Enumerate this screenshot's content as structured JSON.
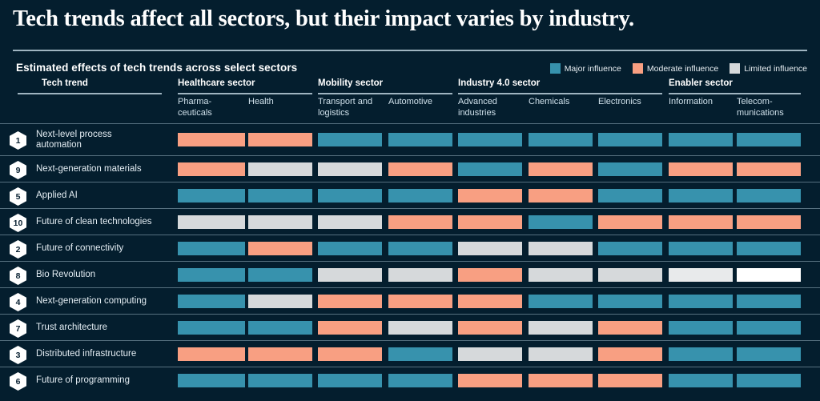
{
  "headline": "Tech trends affect all sectors, but their impact varies by industry.",
  "subhead": "Estimated effects of tech trends across select sectors",
  "legend": {
    "items": [
      {
        "label": "Major influence",
        "key": "major",
        "color": "#3792ad"
      },
      {
        "label": "Moderate influence",
        "key": "moderate",
        "color": "#f89f82"
      },
      {
        "label": "Limited influence",
        "key": "limited",
        "color": "#d6d9db"
      }
    ]
  },
  "row_header_label": "Tech trend",
  "sector_groups": [
    {
      "label": "Healthcare sector",
      "span": 2
    },
    {
      "label": "Mobility sector",
      "span": 2
    },
    {
      "label": "Industry 4.0 sector",
      "span": 3
    },
    {
      "label": "Enabler sector",
      "span": 2
    }
  ],
  "columns": [
    {
      "label": "Pharma-\nceuticals"
    },
    {
      "label": "Health"
    },
    {
      "label": "Transport and\nlogistics"
    },
    {
      "label": "Automotive"
    },
    {
      "label": "Advanced\nindustries"
    },
    {
      "label": "Chemicals"
    },
    {
      "label": "Electronics"
    },
    {
      "label": "Information"
    },
    {
      "label": "Telecom-\nmunications"
    }
  ],
  "chart_data": {
    "type": "heatmap",
    "title": "Estimated effects of tech trends across select sectors",
    "xlabel": "",
    "ylabel": "",
    "categories": [
      "Pharmaceuticals",
      "Health",
      "Transport and logistics",
      "Automotive",
      "Advanced industries",
      "Chemicals",
      "Electronics",
      "Information",
      "Telecommunications"
    ],
    "value_scale": [
      "limited",
      "moderate",
      "major"
    ],
    "legend_position": "top-right",
    "grid": false,
    "rows": [
      {
        "rank": "1",
        "label": "Next-level process automation",
        "values": [
          "moderate",
          "moderate",
          "major",
          "major",
          "major",
          "major",
          "major",
          "major",
          "major"
        ]
      },
      {
        "rank": "9",
        "label": "Next-generation materials",
        "values": [
          "moderate",
          "limited",
          "limited",
          "moderate",
          "major",
          "moderate",
          "major",
          "moderate",
          "moderate"
        ]
      },
      {
        "rank": "5",
        "label": "Applied AI",
        "values": [
          "major",
          "major",
          "major",
          "major",
          "moderate",
          "moderate",
          "major",
          "major",
          "major"
        ]
      },
      {
        "rank": "10",
        "label": "Future of clean technologies",
        "values": [
          "limited",
          "limited",
          "limited",
          "moderate",
          "moderate",
          "major",
          "moderate",
          "moderate",
          "moderate"
        ]
      },
      {
        "rank": "2",
        "label": "Future of connectivity",
        "values": [
          "major",
          "moderate",
          "major",
          "major",
          "limited",
          "limited",
          "major",
          "major",
          "major"
        ]
      },
      {
        "rank": "8",
        "label": "Bio Revolution",
        "values": [
          "major",
          "major",
          "limited",
          "limited",
          "moderate",
          "limited",
          "limited",
          "limited",
          "limited"
        ],
        "highlight": [
          7,
          8
        ]
      },
      {
        "rank": "4",
        "label": "Next-generation computing",
        "values": [
          "major",
          "limited",
          "moderate",
          "moderate",
          "moderate",
          "major",
          "major",
          "major",
          "major"
        ]
      },
      {
        "rank": "7",
        "label": "Trust architecture",
        "values": [
          "major",
          "major",
          "moderate",
          "limited",
          "moderate",
          "limited",
          "moderate",
          "major",
          "major"
        ]
      },
      {
        "rank": "3",
        "label": "Distributed infrastructure",
        "values": [
          "moderate",
          "moderate",
          "moderate",
          "major",
          "limited",
          "limited",
          "moderate",
          "major",
          "major"
        ]
      },
      {
        "rank": "6",
        "label": "Future of programming",
        "values": [
          "major",
          "major",
          "major",
          "major",
          "moderate",
          "moderate",
          "moderate",
          "major",
          "major"
        ]
      }
    ]
  }
}
